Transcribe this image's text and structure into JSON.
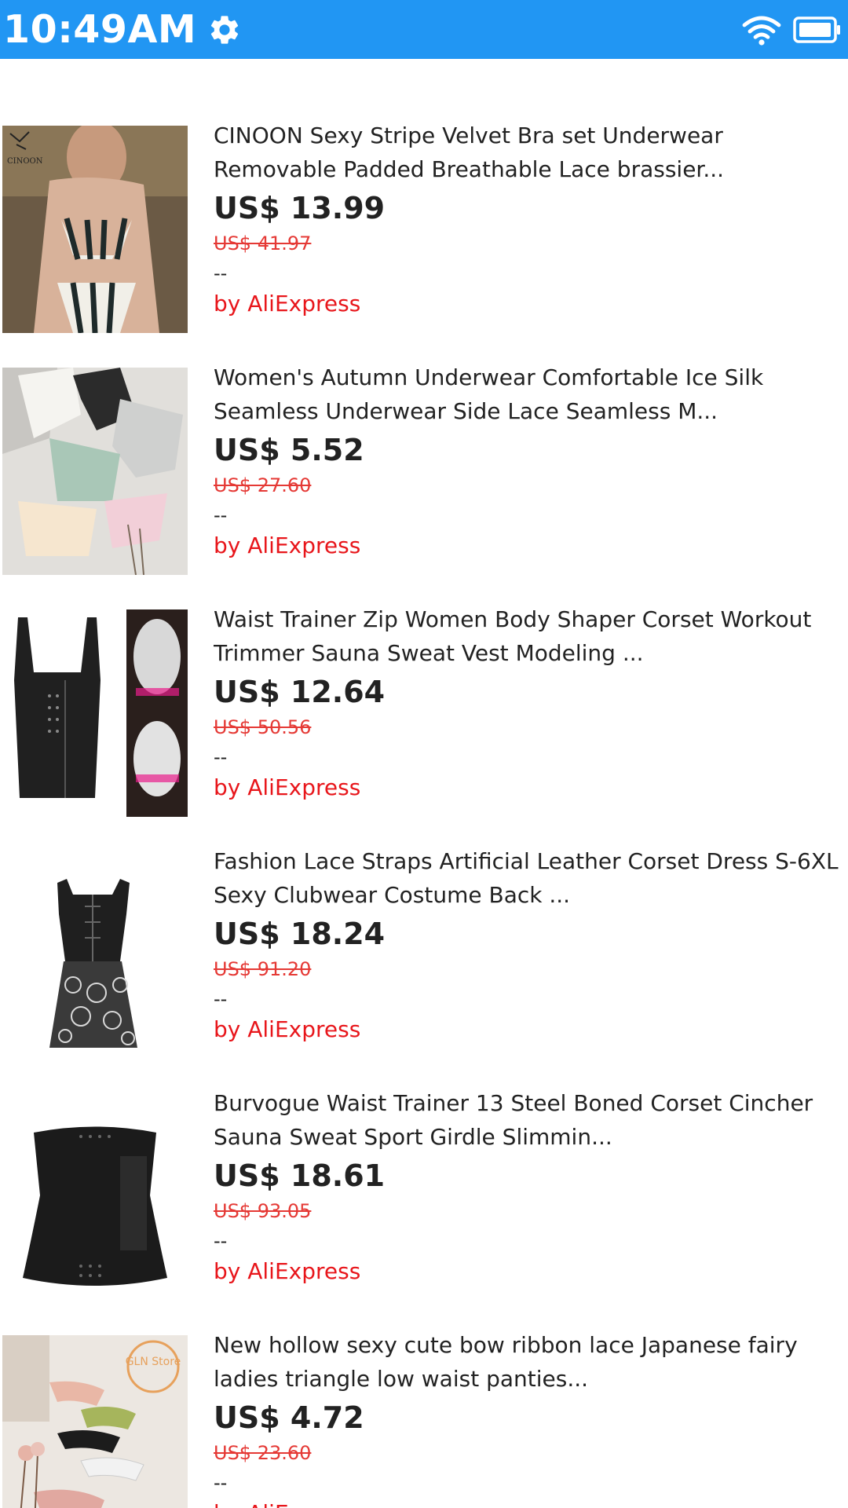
{
  "status_bar": {
    "time": "10:49AM",
    "left_icons": [
      "gear-icon"
    ],
    "right_icons": [
      "wifi-icon",
      "battery-icon"
    ],
    "background": "#2196F3"
  },
  "products": [
    {
      "title": "CINOON Sexy Stripe Velvet Bra set Underwear Removable Padded Breathable Lace brassier...",
      "price": "US$ 13.99",
      "original_price": "US$ 41.97",
      "extra": "--",
      "seller": "by AliExpress",
      "image": "striped-lingerie-photo",
      "image_text": "CINOON"
    },
    {
      "title": "Women's Autumn Underwear Comfortable Ice Silk Seamless Underwear Side Lace Seamless M...",
      "price": "US$ 5.52",
      "original_price": "US$ 27.60",
      "extra": "--",
      "seller": "by AliExpress",
      "image": "folded-panties-photo"
    },
    {
      "title": "Waist Trainer Zip Women Body Shaper Corset Workout Trimmer Sauna Sweat Vest Modeling ...",
      "price": "US$ 12.64",
      "original_price": "US$ 50.56",
      "extra": "--",
      "seller": "by AliExpress",
      "image": "black-vest-shaper-photo"
    },
    {
      "title": "Fashion Lace Straps Artificial Leather Corset Dress S-6XL Sexy Clubwear Costume Back ...",
      "price": "US$ 18.24",
      "original_price": "US$ 91.20",
      "extra": "--",
      "seller": "by AliExpress",
      "image": "black-lace-corset-dress-photo"
    },
    {
      "title": "Burvogue Waist Trainer 13 Steel Boned Corset Cincher Sauna Sweat Sport Girdle Slimmin...",
      "price": "US$ 18.61",
      "original_price": "US$ 93.05",
      "extra": "--",
      "seller": "by AliExpress",
      "image": "black-waist-trainer-photo"
    },
    {
      "title": "New hollow sexy cute bow ribbon lace Japanese fairy ladies triangle low waist panties...",
      "price": "US$ 4.72",
      "original_price": "US$ 23.60",
      "extra": "--",
      "seller": "by AliExpress",
      "image": "lace-panties-flatlay-photo",
      "image_text": "GLN Store"
    }
  ]
}
